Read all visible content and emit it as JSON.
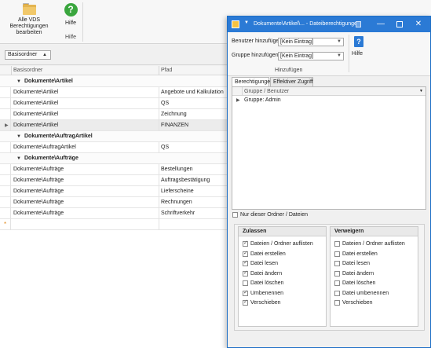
{
  "ribbon": {
    "vds_button_label": "Alle VDS Berechtigungen bearbeiten",
    "help_button_label": "Hilfe",
    "help_group_label": "Hilfe"
  },
  "groupbar": {
    "chip_label": "Basisordner"
  },
  "grid": {
    "columns": [
      "Basisordner",
      "Pfad"
    ],
    "groups": [
      {
        "label": "Dokumente\\Artikel",
        "rows": [
          {
            "basisordner": "Dokumente\\Artikel",
            "pfad": "Angebote und Kalkulation"
          },
          {
            "basisordner": "Dokumente\\Artikel",
            "pfad": "QS"
          },
          {
            "basisordner": "Dokumente\\Artikel",
            "pfad": "Zeichnung"
          },
          {
            "basisordner": "Dokumente\\Artikel",
            "pfad": "FINANZEN"
          }
        ]
      },
      {
        "label": "Dokumente\\AuftragArtikel",
        "rows": [
          {
            "basisordner": "Dokumente\\AuftragArtikel",
            "pfad": "QS"
          }
        ]
      },
      {
        "label": "Dokumente\\Aufträge",
        "rows": [
          {
            "basisordner": "Dokumente\\Aufträge",
            "pfad": "Bestellungen"
          },
          {
            "basisordner": "Dokumente\\Aufträge",
            "pfad": "Auftragsbestätigung"
          },
          {
            "basisordner": "Dokumente\\Aufträge",
            "pfad": "Lieferscheine"
          },
          {
            "basisordner": "Dokumente\\Aufträge",
            "pfad": "Rechnungen"
          },
          {
            "basisordner": "Dokumente\\Aufträge",
            "pfad": "Schriftverkehr"
          }
        ]
      }
    ]
  },
  "dialog": {
    "title": "Dokumente\\Artikel\\... - Dateiberechtigungen",
    "benutzer_label": "Benutzer hinzufügen",
    "benutzer_value": "[Kein Eintrag]",
    "gruppe_label": "Gruppe hinzufügen",
    "gruppe_value": "[Kein Eintrag]",
    "hinzufuegen_group_label": "Hinzufügen",
    "help_label": "Hilfe",
    "tabs": [
      "Berechtigungen",
      "Effektiver Zugriff"
    ],
    "tree_header": "Gruppe / Benutzer",
    "tree_items": [
      "Gruppe: Admin"
    ],
    "only_folder_label": "Nur dieser Ordner / Dateien",
    "allow": {
      "title": "Zulassen",
      "items": [
        {
          "label": "Dateien / Ordner auflisten",
          "checked": true
        },
        {
          "label": "Datei erstellen",
          "checked": true
        },
        {
          "label": "Datei lesen",
          "checked": true
        },
        {
          "label": "Datei ändern",
          "checked": true
        },
        {
          "label": "Datei löschen",
          "checked": false
        },
        {
          "label": "Umbenennen",
          "checked": true
        },
        {
          "label": "Verschieben",
          "checked": true
        }
      ]
    },
    "deny": {
      "title": "Verweigern",
      "items": [
        {
          "label": "Dateien / Ordner auflisten",
          "checked": false
        },
        {
          "label": "Datei erstellen",
          "checked": false
        },
        {
          "label": "Datei lesen",
          "checked": false
        },
        {
          "label": "Datei ändern",
          "checked": false
        },
        {
          "label": "Datei löschen",
          "checked": false
        },
        {
          "label": "Datei umbenennen",
          "checked": false
        },
        {
          "label": "Verschieben",
          "checked": false
        }
      ]
    }
  }
}
